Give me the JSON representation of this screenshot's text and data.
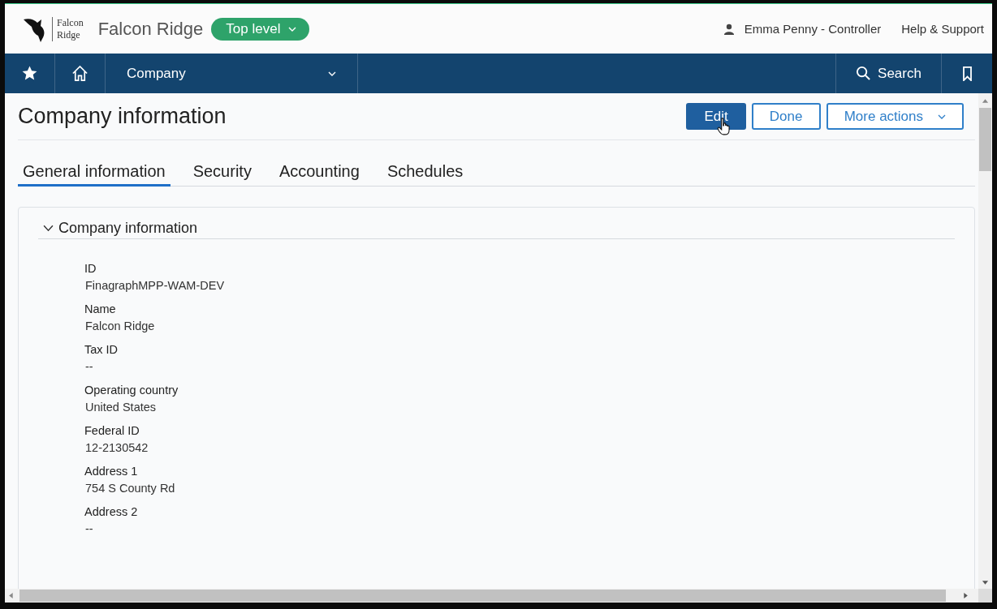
{
  "header": {
    "logo_lines": [
      "Falcon",
      "Ridge"
    ],
    "company": "Falcon Ridge",
    "level_button": "Top level",
    "user": "Emma Penny - Controller",
    "help": "Help & Support"
  },
  "nav": {
    "menu": "Company",
    "search": "Search"
  },
  "page": {
    "title": "Company information",
    "actions": [
      {
        "label": "Edit",
        "kind": "primary"
      },
      {
        "label": "Done",
        "kind": "secondary"
      },
      {
        "label": "More actions",
        "kind": "dropdown"
      }
    ]
  },
  "tabs": [
    {
      "label": "General information",
      "selected": true
    },
    {
      "label": "Security",
      "selected": false
    },
    {
      "label": "Accounting",
      "selected": false
    },
    {
      "label": "Schedules",
      "selected": false
    }
  ],
  "section": {
    "title": "Company information",
    "expanded": true,
    "fields": [
      {
        "label": "ID",
        "value": "FinagraphMPP-WAM-DEV"
      },
      {
        "label": "Name",
        "value": "Falcon Ridge"
      },
      {
        "label": "Tax ID",
        "value": "--"
      },
      {
        "label": "Operating country",
        "value": "United States"
      },
      {
        "label": "Federal ID",
        "value": "12-2130542"
      },
      {
        "label": "Address 1",
        "value": "754 S County Rd"
      },
      {
        "label": "Address 2",
        "value": "--"
      }
    ]
  }
}
